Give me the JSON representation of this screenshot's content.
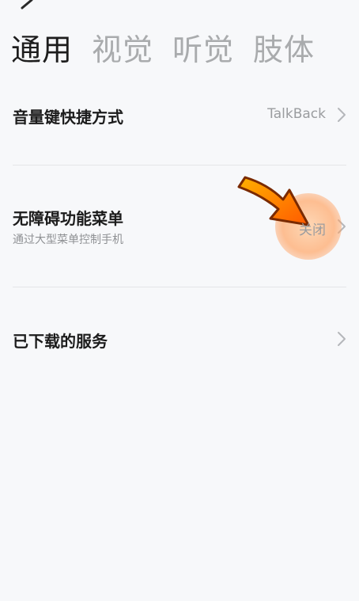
{
  "header": {
    "back_icon": "back-arrow-icon"
  },
  "tabs": [
    {
      "label": "通用",
      "active": true
    },
    {
      "label": "视觉",
      "active": false
    },
    {
      "label": "听觉",
      "active": false
    },
    {
      "label": "肢体",
      "active": false
    }
  ],
  "settings": {
    "volume_shortcut": {
      "title": "音量键快捷方式",
      "value": "TalkBack"
    },
    "accessibility_menu": {
      "title": "无障碍功能菜单",
      "subtitle": "通过大型菜单控制手机",
      "value": "关闭"
    },
    "downloaded_services": {
      "title": "已下载的服务"
    }
  },
  "annotation": {
    "arrow_color": "#ff7a00",
    "highlight_color": "#ffb27a"
  }
}
